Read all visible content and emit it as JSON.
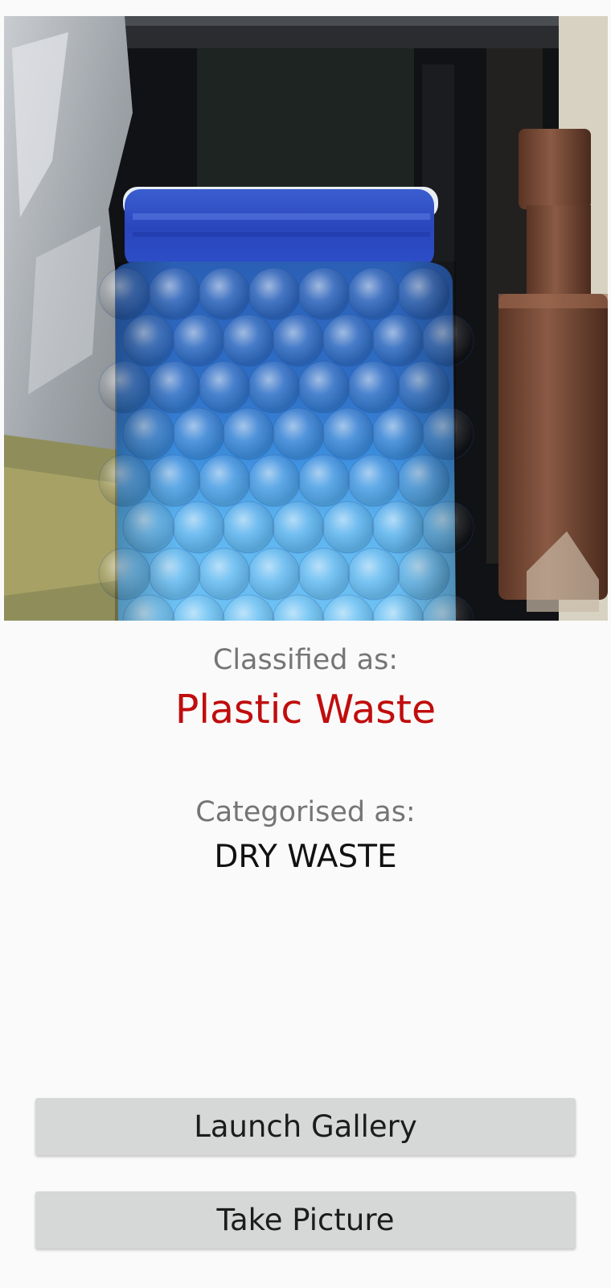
{
  "photo": {
    "alt": "Plastic Waste"
  },
  "result": {
    "classified_caption": "Classified as:",
    "classified_value": "Plastic Waste",
    "categorised_caption": "Categorised as:",
    "categorised_value": "DRY WASTE"
  },
  "actions": {
    "launch_gallery_label": "Launch Gallery",
    "take_picture_label": "Take Picture"
  },
  "colors": {
    "background": "#fafafa",
    "classification_text": "#c00d0d",
    "caption_text": "#757575",
    "button_background": "#d6d7d7"
  }
}
